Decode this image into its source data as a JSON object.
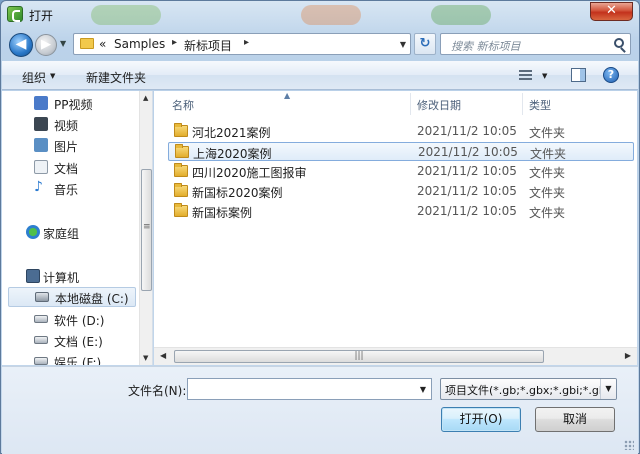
{
  "window": {
    "title": "打开",
    "close_label": "✕"
  },
  "nav": {
    "back_glyph": "◀",
    "forward_glyph": "▶",
    "history_glyph": "▼"
  },
  "address": {
    "prefix": "«",
    "crumbs": [
      "Samples",
      "新标项目"
    ],
    "separator": "▸",
    "dropdown_glyph": "▼",
    "refresh_glyph": "↻"
  },
  "search": {
    "placeholder": "搜索 新标项目"
  },
  "toolbar": {
    "organize_label": "组织",
    "new_folder_label": "新建文件夹",
    "help_glyph": "?"
  },
  "sidebar": {
    "items": [
      {
        "label": "PP视频",
        "icon": "pp-video-icon",
        "color": "#4a7ac9"
      },
      {
        "label": "视频",
        "icon": "video-icon",
        "color": "#3b4652"
      },
      {
        "label": "图片",
        "icon": "pictures-icon",
        "color": "#5a8fc4"
      },
      {
        "label": "文档",
        "icon": "documents-icon",
        "color": "#d9dfe6"
      },
      {
        "label": "音乐",
        "icon": "music-icon",
        "color": "#2a7ad0"
      },
      {
        "label": "家庭组",
        "icon": "homegroup-icon",
        "color": "#3ea33a"
      },
      {
        "label": "计算机",
        "icon": "computer-icon",
        "color": "#4b6c92"
      },
      {
        "label": "本地磁盘 (C:)",
        "icon": "drive-c-icon",
        "color": "#8f9aa6"
      },
      {
        "label": "软件 (D:)",
        "icon": "drive-d-icon",
        "color": "#aab3bd"
      },
      {
        "label": "文档 (E:)",
        "icon": "drive-e-icon",
        "color": "#aab3bd"
      },
      {
        "label": "娱乐 (F:)",
        "icon": "drive-f-icon",
        "color": "#aab3bd"
      }
    ],
    "selected_index": 7
  },
  "columns": {
    "name": "名称",
    "date": "修改日期",
    "type": "类型"
  },
  "files": [
    {
      "name": "河北2021案例",
      "date": "2021/11/2 10:05",
      "type": "文件夹"
    },
    {
      "name": "上海2020案例",
      "date": "2021/11/2 10:05",
      "type": "文件夹"
    },
    {
      "name": "四川2020施工图报审",
      "date": "2021/11/2 10:05",
      "type": "文件夹"
    },
    {
      "name": "新国标2020案例",
      "date": "2021/11/2 10:05",
      "type": "文件夹"
    },
    {
      "name": "新国标案例",
      "date": "2021/11/2 10:05",
      "type": "文件夹"
    }
  ],
  "selected_file_index": 1,
  "footer": {
    "filename_label": "文件名(N):",
    "filename_value": "",
    "filetype_value": "项目文件(*.gb;*.gbx;*.gbi;*.gb",
    "open_label": "打开(O)",
    "cancel_label": "取消"
  }
}
